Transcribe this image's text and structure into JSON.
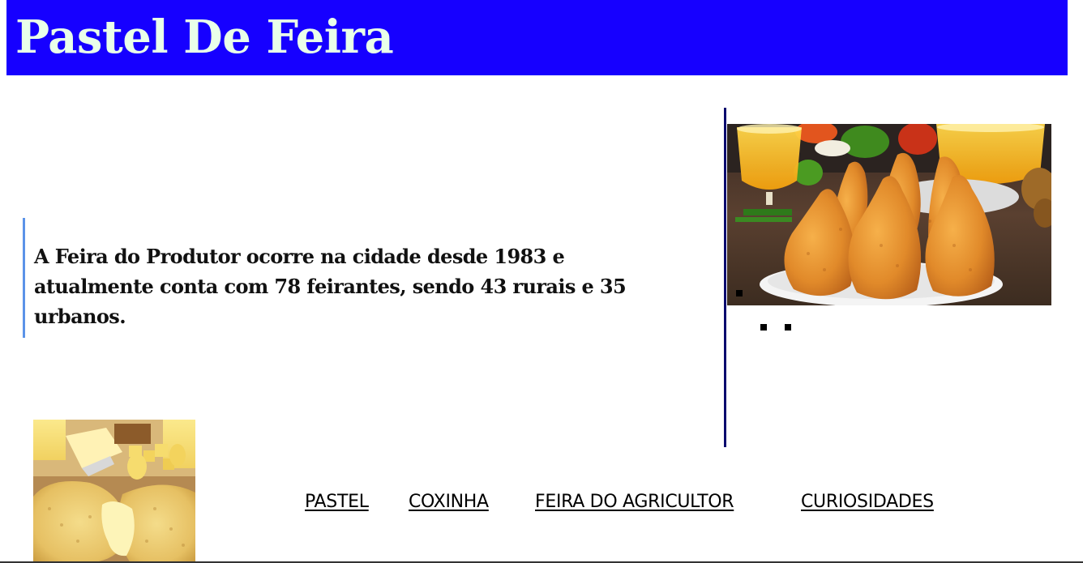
{
  "header": {
    "title": "Pastel De Feira",
    "background_color": "#1600ff",
    "title_color": "#e9ffe9"
  },
  "main": {
    "quote_text": "A Feira do Produtor ocorre na cidade desde 1983 e atualmente conta com 78 feirantes, sendo 43 rurais e 35 urbanos.",
    "quote_border_color": "#5b93e8"
  },
  "aside": {
    "image": "coxinha-photo",
    "border_color": "#0a0a6e"
  },
  "footer": {
    "image": "pastel-photo"
  },
  "nav": {
    "items": [
      {
        "label": "PASTEL"
      },
      {
        "label": "COXINHA"
      },
      {
        "label": "FEIRA DO AGRICULTOR"
      },
      {
        "label": "CURIOSIDADES"
      }
    ]
  }
}
